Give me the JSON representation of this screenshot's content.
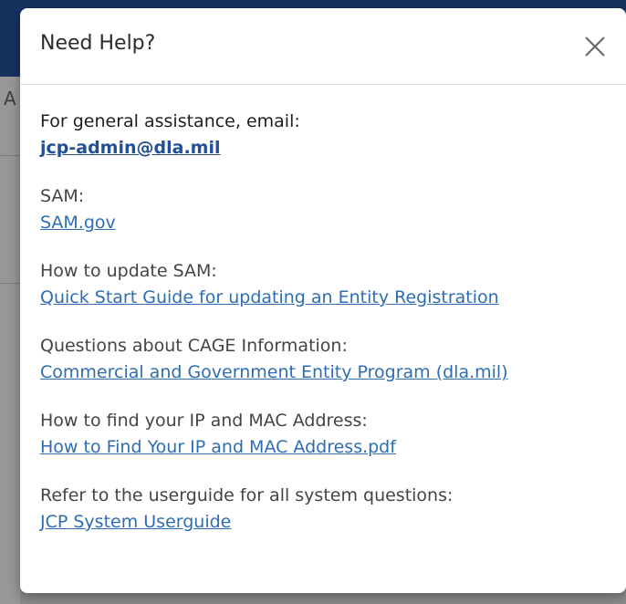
{
  "modal": {
    "title": "Need Help?",
    "sections": [
      {
        "label": "For general assistance, email:",
        "link": "jcp-admin@dla.mil"
      },
      {
        "label": "SAM:",
        "link": "SAM.gov"
      },
      {
        "label": "How to update SAM:",
        "link": "Quick Start Guide for updating an Entity Registration"
      },
      {
        "label": "Questions about CAGE Information:",
        "link": "Commercial and Government Entity Program (dla.mil)"
      },
      {
        "label": "How to find your IP and MAC Address:",
        "link": "How to Find Your IP and MAC Address.pdf"
      },
      {
        "label": "Refer to the userguide for all system questions:",
        "link": "JCP System Userguide"
      }
    ]
  },
  "background": {
    "partial_text": "A"
  },
  "colors": {
    "header_bg": "#15325f",
    "link": "#2f6db3",
    "overlay": "#8c8c8c"
  },
  "icons": {
    "close": "close-icon"
  }
}
